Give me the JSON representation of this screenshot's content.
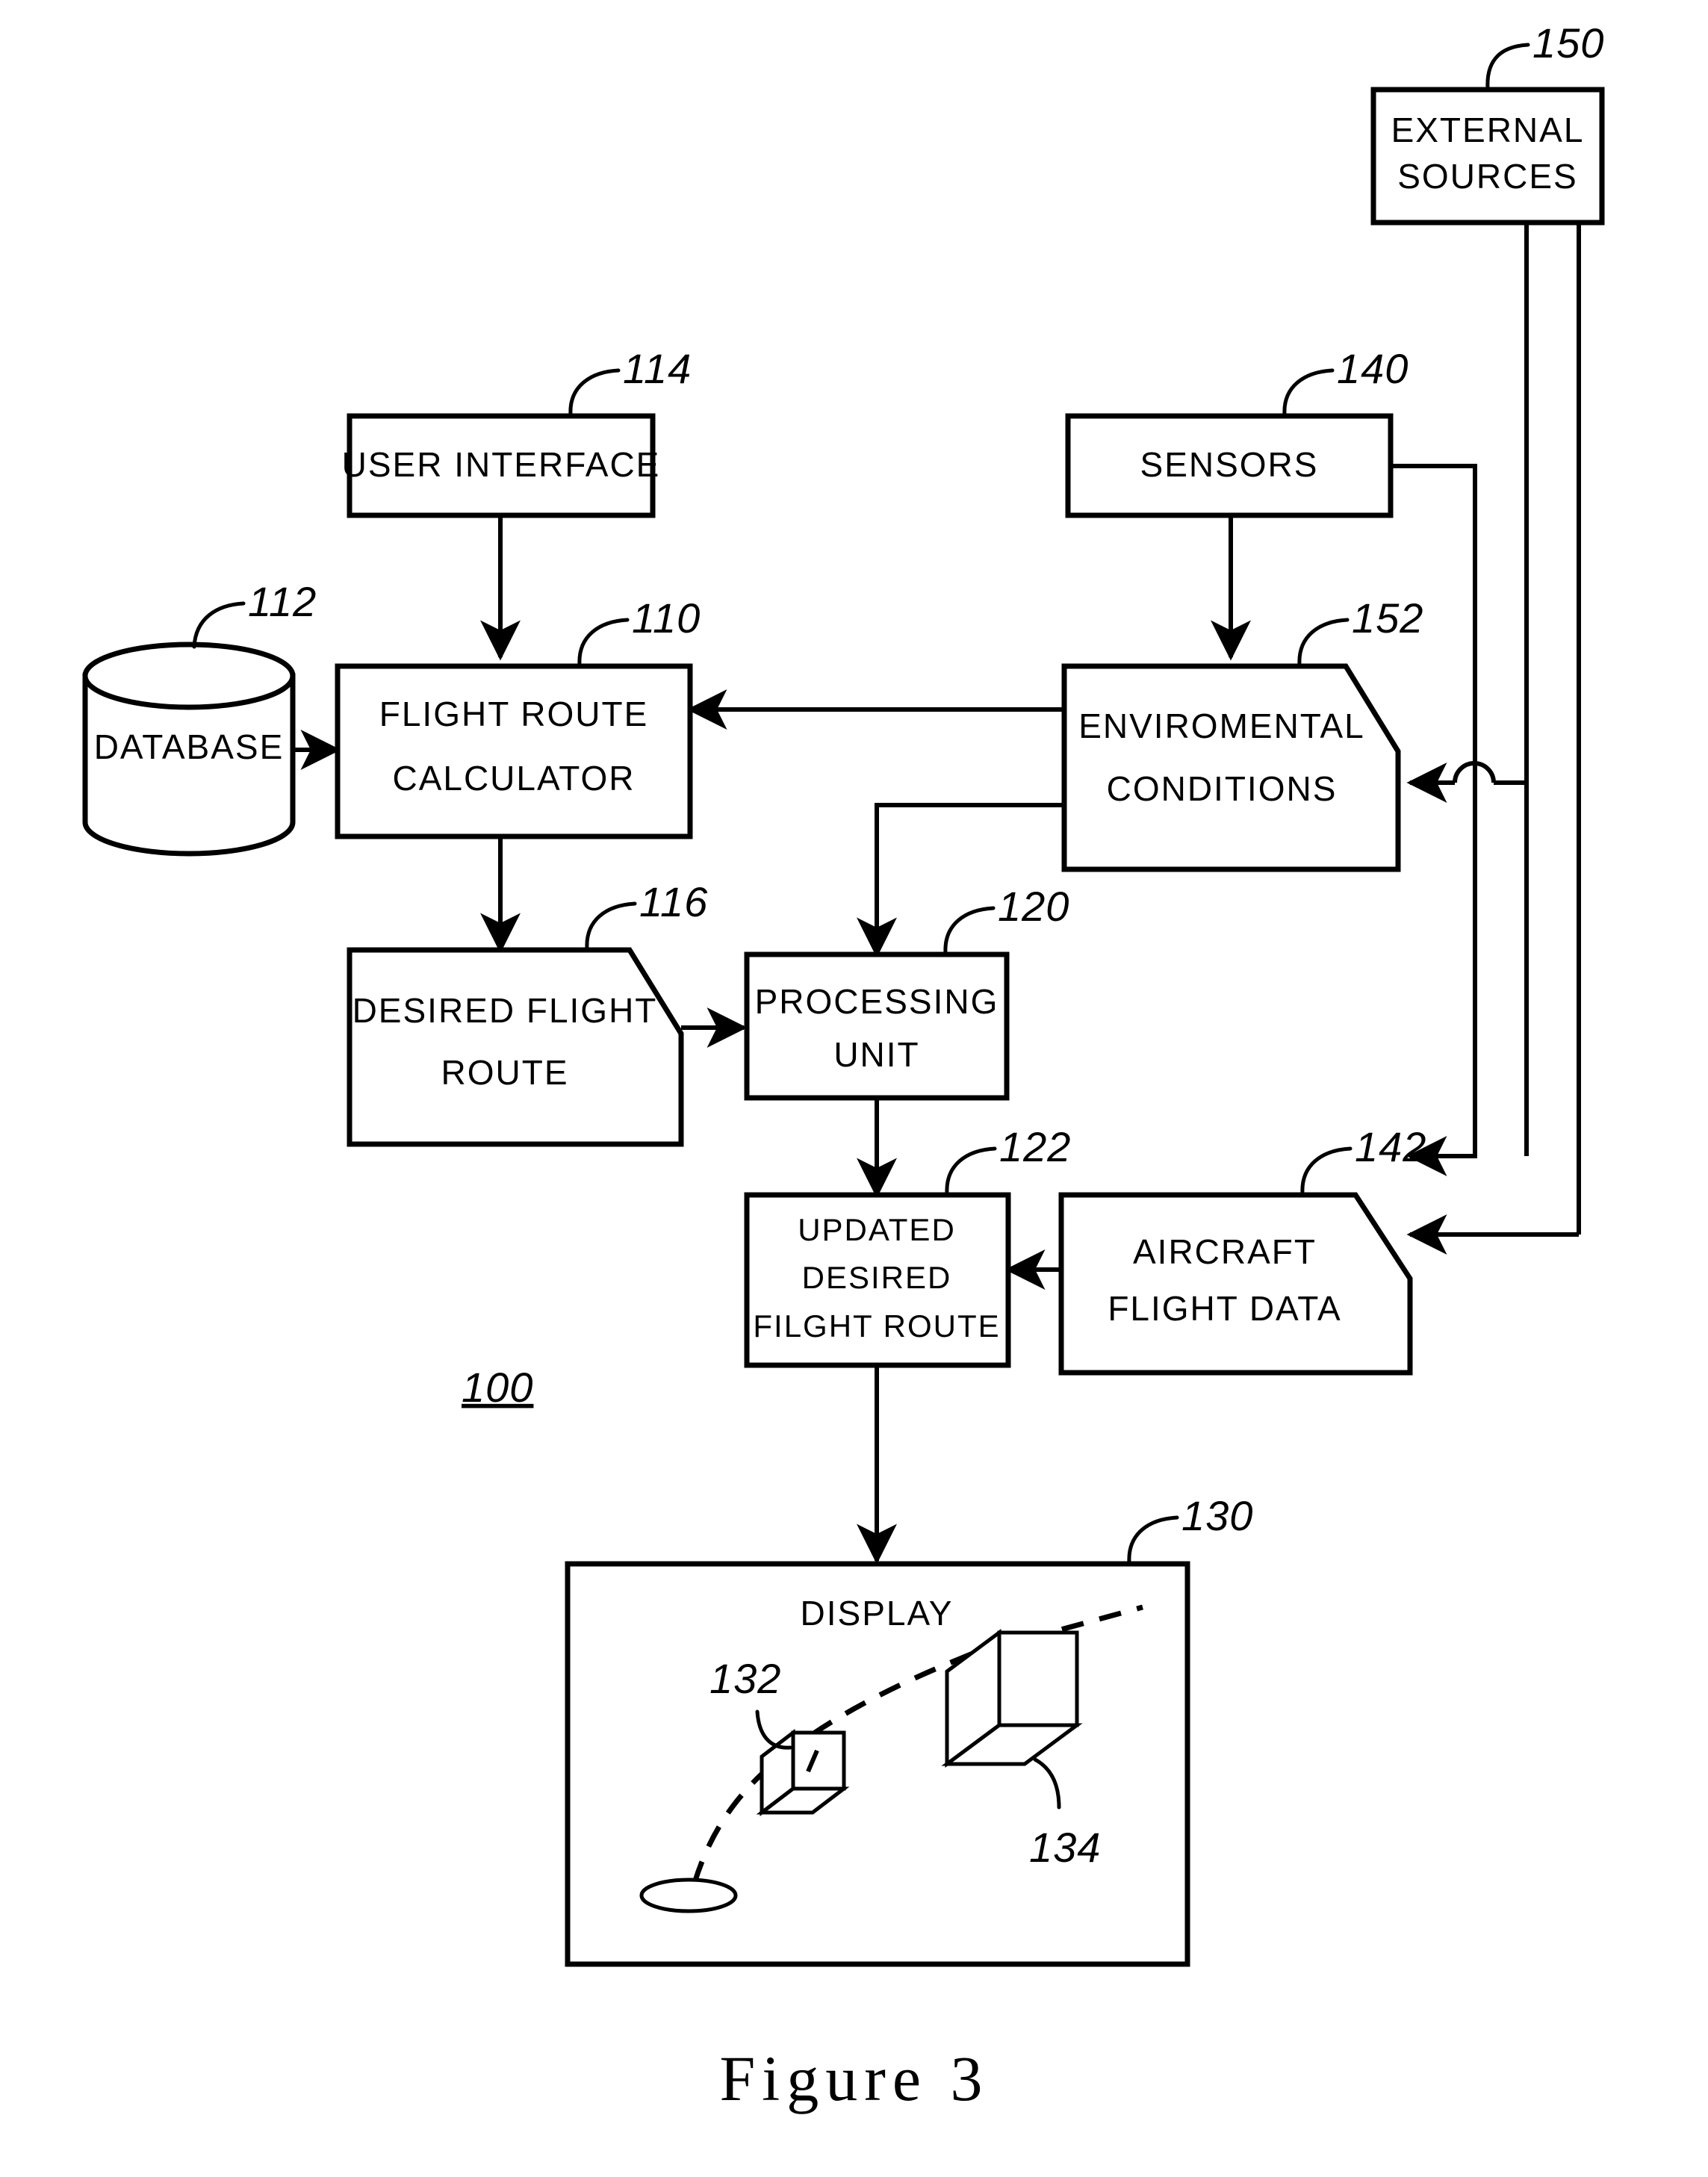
{
  "figure": {
    "caption": "Figure 3",
    "system_ref": "100"
  },
  "nodes": {
    "external_sources": {
      "label_line1": "EXTERNAL",
      "label_line2": "SOURCES",
      "ref": "150",
      "shape": "rect"
    },
    "user_interface": {
      "label_line1": "USER  INTERFACE",
      "ref": "114",
      "shape": "rect"
    },
    "sensors": {
      "label_line1": "SENSORS",
      "ref": "140",
      "shape": "rect"
    },
    "database": {
      "label_line1": "DATABASE",
      "ref": "112",
      "shape": "cylinder"
    },
    "flight_route_calculator": {
      "label_line1": "FLIGHT  ROUTE",
      "label_line2": "CALCULATOR",
      "ref": "110",
      "shape": "rect"
    },
    "environmental_conditions": {
      "label_line1": "ENVIROMENTAL",
      "label_line2": "CONDITIONS",
      "ref": "152",
      "shape": "cut-corner"
    },
    "desired_flight_route": {
      "label_line1": "DESIRED  FLIGHT",
      "label_line2": "ROUTE",
      "ref": "116",
      "shape": "cut-corner"
    },
    "processing_unit": {
      "label_line1": "PROCESSING",
      "label_line2": "UNIT",
      "ref": "120",
      "shape": "rect"
    },
    "updated_desired_flight_route": {
      "label_line1": "UPDATED",
      "label_line2": "DESIRED",
      "label_line3": "FILGHT  ROUTE",
      "ref": "122",
      "shape": "rect"
    },
    "aircraft_flight_data": {
      "label_line1": "AIRCRAFT",
      "label_line2": "FLIGHT  DATA",
      "ref": "142",
      "shape": "cut-corner"
    },
    "display": {
      "label_line1": "DISPLAY",
      "ref": "130",
      "shape": "rect"
    }
  },
  "display_contents": {
    "aircraft_small_ref": "132",
    "aircraft_large_ref": "134"
  },
  "colors": {
    "ink": "#000000",
    "paper": "#ffffff"
  }
}
